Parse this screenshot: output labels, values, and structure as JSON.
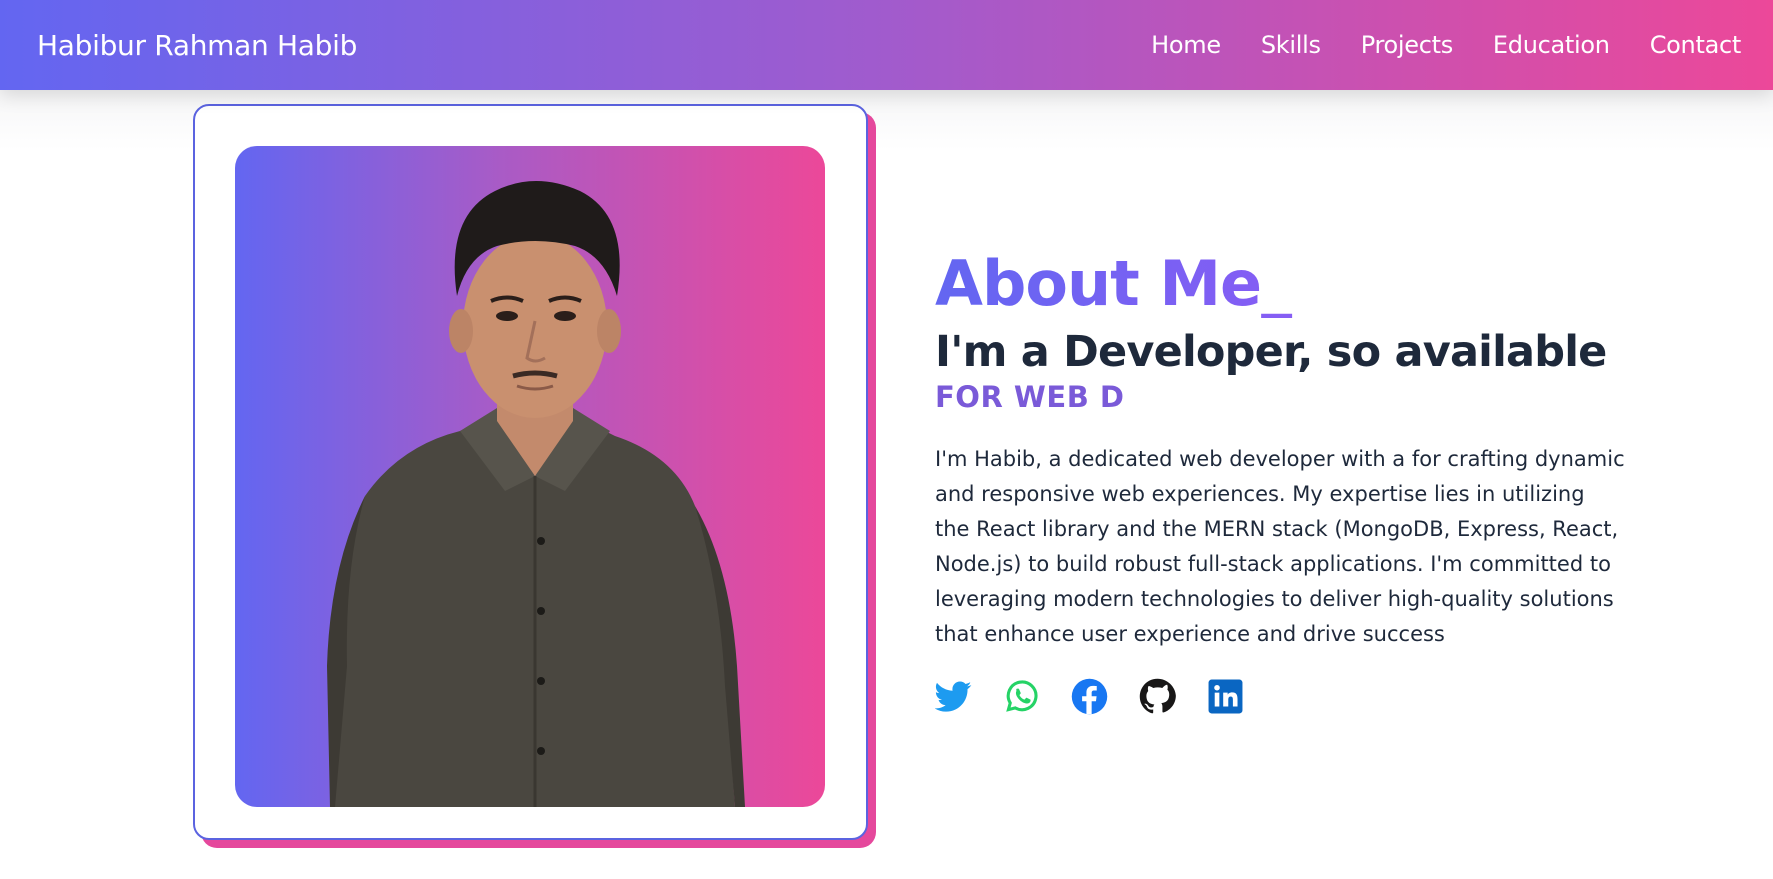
{
  "nav": {
    "brand": "Habibur Rahman Habib",
    "links": [
      "Home",
      "Skills",
      "Projects",
      "Education",
      "Contact"
    ]
  },
  "about": {
    "title": "About Me_",
    "headline": "I'm a Developer, so available",
    "typed": "FOR WEB D",
    "bio": "I'm Habib, a dedicated web developer with a for crafting dynamic and responsive web experiences. My expertise lies in utilizing the React library and the MERN stack (MongoDB, Express, React, Node.js) to build robust full-stack applications. I'm committed to leveraging modern technologies to deliver high-quality solutions that enhance user experience and drive success"
  },
  "socials": [
    {
      "icon": "twitter-icon",
      "color": "#1d9bf0"
    },
    {
      "icon": "whatsapp-icon",
      "color": "#25d366"
    },
    {
      "icon": "facebook-icon",
      "color": "#1877f2"
    },
    {
      "icon": "github-icon",
      "color": "#181717"
    },
    {
      "icon": "linkedin-icon",
      "color": "#0a66c2"
    }
  ],
  "colors": {
    "gradient_start": "#6366f1",
    "gradient_end": "#ec4899",
    "text_dark": "#1e293b"
  }
}
